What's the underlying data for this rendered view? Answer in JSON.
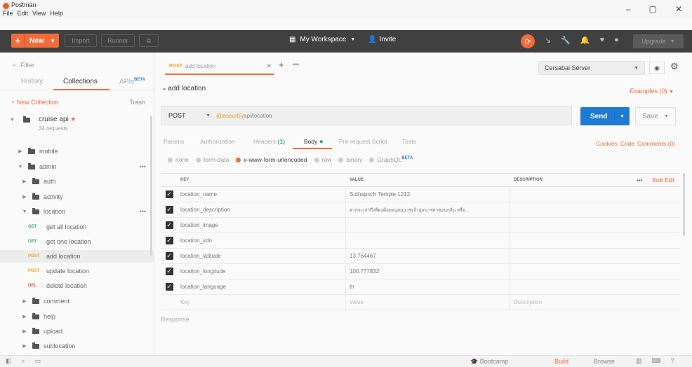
{
  "window": {
    "app_title": "Postman",
    "menus": [
      "File",
      "Edit",
      "View",
      "Help"
    ],
    "controls": [
      "–",
      "▢",
      "✕"
    ]
  },
  "toolbar": {
    "new_label": "New",
    "import_label": "Import",
    "runner_label": "Runner",
    "workspace_label": "My Workspace",
    "invite_label": "Invite",
    "upgrade_label": "Upgrade",
    "accent_color": "#f26b3a"
  },
  "sidebar": {
    "filter_placeholder": "Filter",
    "tabs": [
      "History",
      "Collections",
      "APIs"
    ],
    "api_beta": "BETA",
    "new_collection_label": "+ New Collection",
    "trash_label": "Trash",
    "collection": {
      "name": "cruise api",
      "star": "★",
      "count": "34 requests"
    },
    "tree": [
      {
        "label": "mobile"
      },
      {
        "label": "admin"
      },
      {
        "label": "auth"
      },
      {
        "label": "activity"
      },
      {
        "label": "location"
      },
      {
        "method": "GET",
        "label": "get all location"
      },
      {
        "method": "GET",
        "label": "get one location"
      },
      {
        "method": "POST",
        "label": "add location"
      },
      {
        "method": "POST",
        "label": "update location"
      },
      {
        "method": "DEL",
        "label": "delete location"
      },
      {
        "label": "comment"
      },
      {
        "label": "help"
      },
      {
        "label": "upload"
      },
      {
        "label": "sublocation"
      }
    ]
  },
  "request": {
    "tab_method": "POST",
    "tab_name": "add location",
    "title": "add location",
    "environment": "Cersabai Server",
    "examples_label": "Examples (0)",
    "method": "POST",
    "url_var": "{{baseurl}}",
    "url_path": "/api/location",
    "send_label": "Send",
    "save_label": "Save",
    "subtabs": {
      "params": "Params",
      "authorization": "Authorization",
      "headers": "Headers",
      "headers_count": "(1)",
      "body": "Body",
      "prerequest": "Pre-request Script",
      "tests": "Tests"
    },
    "links": {
      "cookies": "Cookies",
      "code": "Code",
      "comments": "Comments (0)"
    },
    "body_types": {
      "none": "none",
      "form_data": "form-data",
      "urlencoded": "x-www-form-urlencoded",
      "raw": "raw",
      "binary": "binary",
      "graphql": "GraphQL",
      "graphql_beta": "BETA"
    },
    "table": {
      "headers": {
        "key": "KEY",
        "value": "VALUE",
        "description": "DESCRIPTION",
        "more": "•••",
        "bulk_edit": "Bulk Edit"
      },
      "rows": [
        {
          "key": "location_name",
          "value": "Suthapoch Temple 1212"
        },
        {
          "key": "location_description",
          "value": "หากจะเล่าถึงที่ดงด้อยอนุสมนวชเจ้าอุ่มนารดาชอนกลิน หรือ..."
        },
        {
          "key": "location_image",
          "value": ""
        },
        {
          "key": "location_vdo",
          "value": ""
        },
        {
          "key": "location_latitude",
          "value": "13.764467"
        },
        {
          "key": "location_longitude",
          "value": "100.777832"
        },
        {
          "key": "location_language",
          "value": "th"
        }
      ],
      "placeholder": {
        "key": "Key",
        "value": "Value",
        "description": "Description"
      }
    },
    "response_label": "Response"
  },
  "statusbar": {
    "bootcamp": "Bootcamp",
    "build": "Build",
    "browse": "Browse"
  }
}
